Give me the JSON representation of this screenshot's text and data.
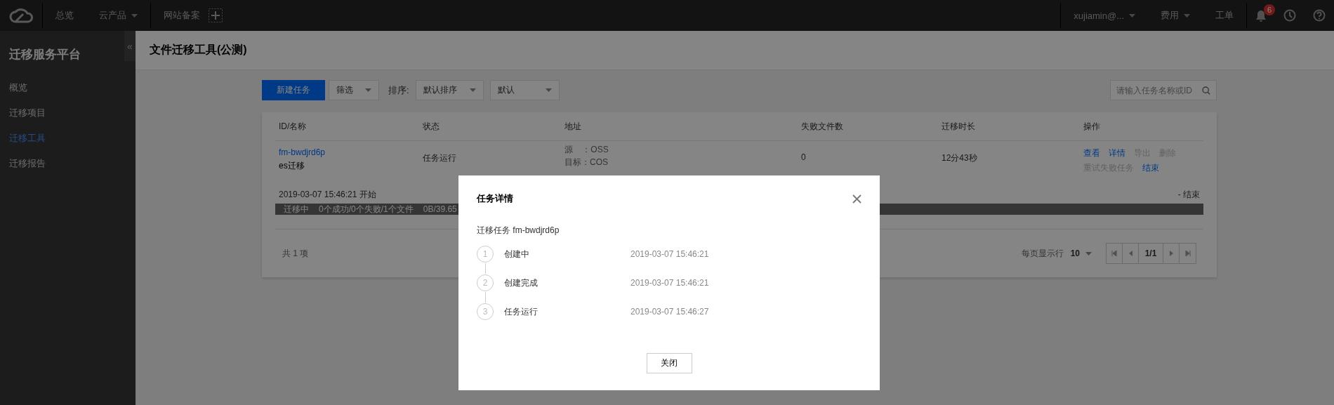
{
  "topbar": {
    "nav": [
      {
        "label": "总览",
        "dropdown": false
      },
      {
        "label": "云产品",
        "dropdown": true
      }
    ],
    "filing": "网站备案",
    "user": "xujiamin@...",
    "billing": "费用",
    "ticket": "工单",
    "notification_count": "6"
  },
  "sidebar": {
    "title": "迁移服务平台",
    "collapse": "«",
    "items": [
      {
        "label": "概览",
        "selected": false
      },
      {
        "label": "迁移项目",
        "selected": false
      },
      {
        "label": "迁移工具",
        "selected": true
      },
      {
        "label": "迁移报告",
        "selected": false
      }
    ]
  },
  "page": {
    "title": "文件迁移工具(公测)"
  },
  "toolbar": {
    "new_button": "新建任务",
    "filter": "筛选",
    "sort_label": "排序:",
    "sort_field": "默认排序",
    "sort_order": "默认",
    "search": {
      "placeholder": "请输入任务名称或ID"
    }
  },
  "table": {
    "columns": [
      "ID/名称",
      "状态",
      "地址",
      "失败文件数",
      "迁移时长",
      "操作"
    ],
    "rows": [
      {
        "id": "fm-bwdjrd6p",
        "name": "es迁移",
        "status": "任务运行",
        "source": "源    ：OSS",
        "target": "目标：COS",
        "failed_files": "0",
        "duration": "12分43秒",
        "actions": [
          {
            "label": "查看",
            "disabled": false
          },
          {
            "label": "详情",
            "disabled": false
          },
          {
            "label": "导出",
            "disabled": true
          },
          {
            "label": "删除",
            "disabled": true
          },
          {
            "label": "重试失败任务",
            "disabled": true
          },
          {
            "label": "结束",
            "disabled": false
          }
        ],
        "start": "2019-03-07 15:46:21 开始",
        "end": "- 结束",
        "progress": {
          "state": "迁移中",
          "counts": "0个成功/0个失败/1个文件",
          "bytes": "0B/39.65"
        }
      }
    ],
    "total": "共 1 项",
    "page_size_label": "每页显示行",
    "page_size": "10",
    "page": "1/1"
  },
  "modal": {
    "title": "任务详情",
    "subtitle": "迁移任务 fm-bwdjrd6p",
    "steps": [
      {
        "number": "1",
        "label": "创建中",
        "time": "2019-03-07 15:46:21"
      },
      {
        "number": "2",
        "label": "创建完成",
        "time": "2019-03-07 15:46:21"
      },
      {
        "number": "3",
        "label": "任务运行",
        "time": "2019-03-07 15:46:27"
      }
    ],
    "close_button": "关闭"
  }
}
